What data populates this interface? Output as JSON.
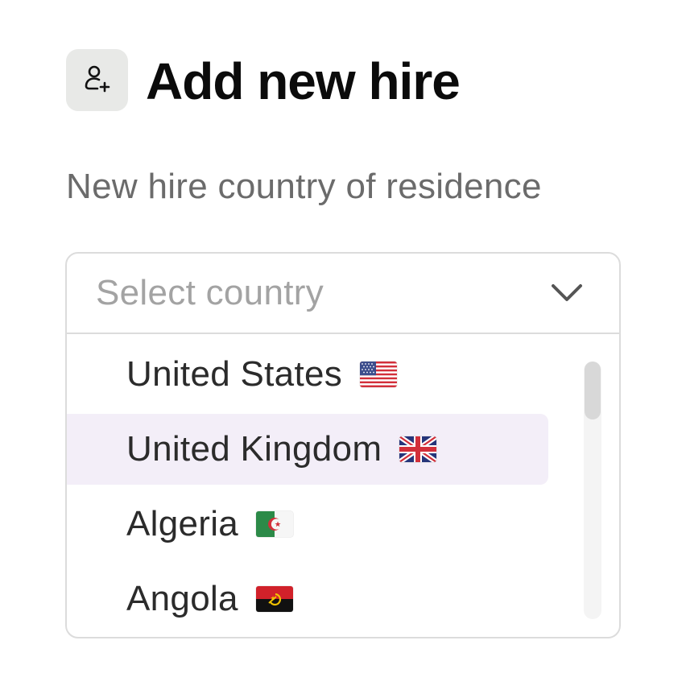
{
  "header": {
    "icon": "user-plus-icon",
    "title": "Add new hire"
  },
  "field": {
    "label": "New hire country of residence",
    "placeholder": "Select country",
    "chevron_icon": "chevron-down-icon"
  },
  "options": [
    {
      "label": "United States",
      "flag_icon": "flag-us-icon",
      "highlighted": false
    },
    {
      "label": "United Kingdom",
      "flag_icon": "flag-gb-icon",
      "highlighted": true
    },
    {
      "label": "Algeria",
      "flag_icon": "flag-dz-icon",
      "highlighted": false
    },
    {
      "label": "Angola",
      "flag_icon": "flag-ao-icon",
      "highlighted": false
    }
  ],
  "colors": {
    "highlight": "#f3eef8",
    "icon_tile": "#e8e9e7",
    "border": "#dcdcdc",
    "placeholder": "#a3a3a3"
  }
}
